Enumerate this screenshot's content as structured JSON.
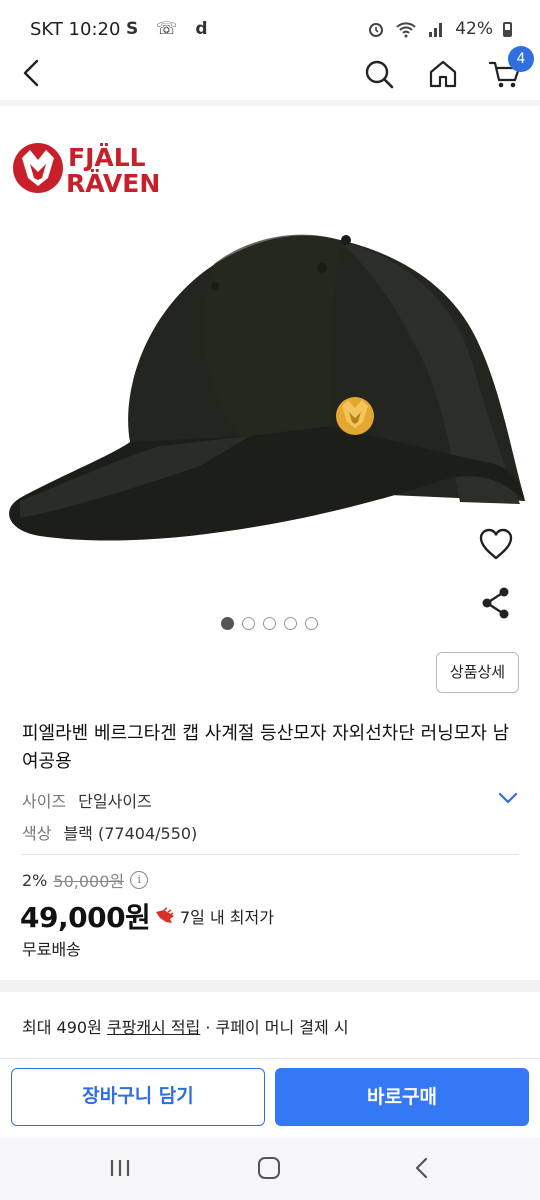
{
  "status_bar": {
    "time": "SKT 10:20",
    "notif_icons": "S ☏ d",
    "battery": "42%"
  },
  "nav": {
    "cart_count": "4"
  },
  "brand": {
    "logo_text_1": "FJÄLL",
    "logo_text_2": "RÄVEN",
    "logo_color": "#c8202b"
  },
  "gallery": {
    "total": 5,
    "active_index": 0
  },
  "product": {
    "detail_button": "상품상세",
    "title": "피엘라벤 베르그타겐 캡 사계절 등산모자 자외선차단 러닝모자 남여공용",
    "options": [
      {
        "key": "사이즈",
        "value": "단일사이즈"
      },
      {
        "key": "색상",
        "value": "블랙 (77404/550)"
      }
    ],
    "discount_rate": "2%",
    "original_price": "50,000원",
    "price": "49,000원",
    "lowest_label": "7일 내 최저가",
    "shipping": "무료배송"
  },
  "cash": {
    "prefix": "최대 490원 ",
    "link": "쿠팡캐시 적립",
    "suffix": " · 쿠페이 머니 결제 시"
  },
  "actions": {
    "add_to_cart": "장바구니 담기",
    "buy_now": "바로구매"
  },
  "colors": {
    "accent": "#3478f6",
    "accent_border": "#2f6fe0"
  }
}
